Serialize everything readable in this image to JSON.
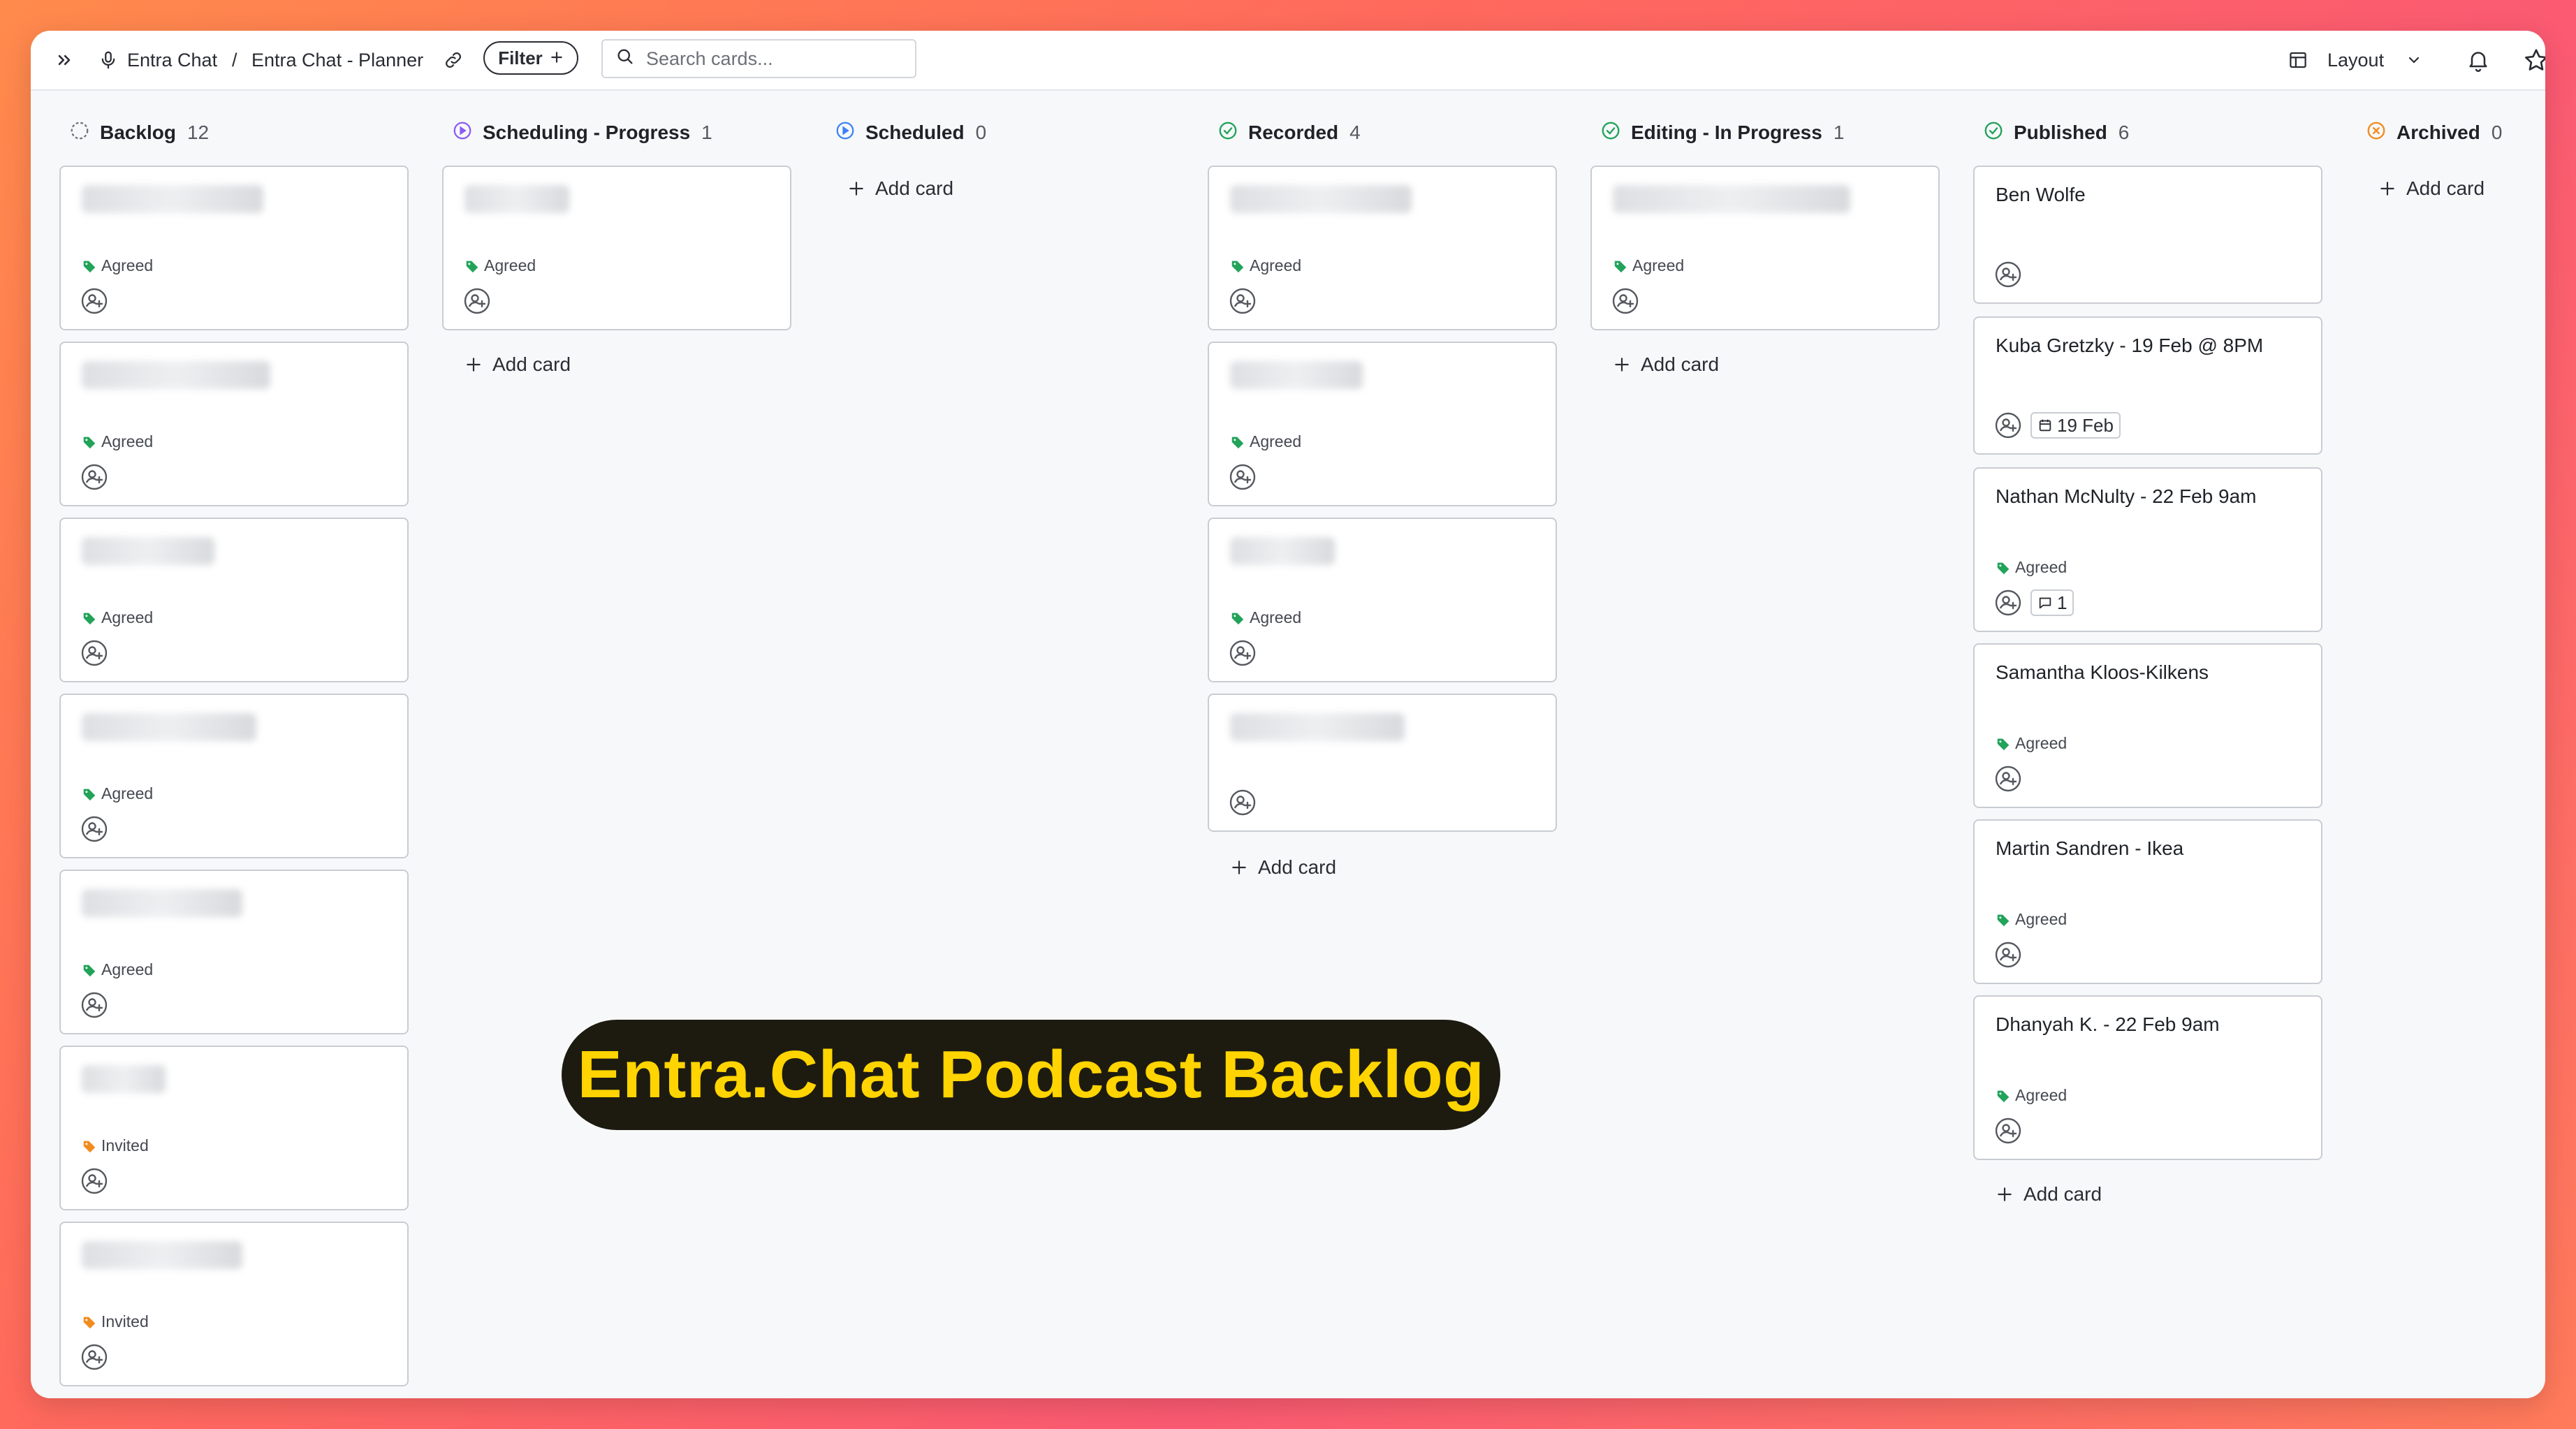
{
  "breadcrumb": {
    "workspace": "Entra Chat",
    "separator": "/",
    "page": "Entra Chat - Planner"
  },
  "filter_label": "Filter",
  "search": {
    "placeholder": "Search cards..."
  },
  "layout_label": "Layout",
  "colors": {
    "agreed_tag": "#22a35a",
    "invited_tag": "#f28c1e",
    "scheduled_icon": "#3b82f6",
    "progress_icon": "#8b5cf6",
    "done_icon": "#22a35a",
    "archived_icon": "#f28c1e",
    "banner_bg": "#1d1b10",
    "banner_text": "#ffd400"
  },
  "columns": [
    {
      "title": "Backlog",
      "count": "12",
      "icon": "dashed-circle-icon",
      "cards": [
        {
          "tag": "Agreed"
        },
        {
          "tag": "Agreed"
        },
        {
          "tag": "Agreed"
        },
        {
          "tag": "Agreed"
        },
        {
          "tag": "Agreed"
        },
        {
          "tag": "Invited"
        },
        {
          "tag": "Invited"
        }
      ]
    },
    {
      "title": "Scheduling - Progress",
      "count": "1",
      "icon": "play-circle-icon",
      "cards": [
        {
          "tag": "Agreed"
        }
      ],
      "add_card": "Add card"
    },
    {
      "title": "Scheduled",
      "count": "0",
      "icon": "play-circle-icon",
      "cards": [],
      "add_card": "Add card"
    },
    {
      "title": "Recorded",
      "count": "4",
      "icon": "check-circle-icon",
      "cards": [
        {
          "tag": "Agreed"
        },
        {
          "tag": "Agreed"
        },
        {
          "tag": "Agreed"
        },
        {
          "tag": ""
        }
      ],
      "add_card": "Add card"
    },
    {
      "title": "Editing - In Progress",
      "count": "1",
      "icon": "check-circle-icon",
      "cards": [
        {
          "tag": "Agreed"
        }
      ],
      "add_card": "Add card"
    },
    {
      "title": "Published",
      "count": "6",
      "icon": "check-circle-icon",
      "cards": [
        {
          "title": "Ben Wolfe"
        },
        {
          "title": "Kuba Gretzky - 19 Feb @ 8PM",
          "date": "19 Feb"
        },
        {
          "title": "Nathan McNulty - 22 Feb 9am",
          "tag": "Agreed",
          "comments": "1"
        },
        {
          "title": "Samantha Kloos-Kilkens",
          "tag": "Agreed"
        },
        {
          "title": "Martin Sandren - Ikea",
          "tag": "Agreed"
        },
        {
          "title": "Dhanyah K. - 22 Feb 9am",
          "tag": "Agreed"
        }
      ],
      "add_card": "Add card"
    },
    {
      "title": "Archived",
      "count": "0",
      "icon": "x-circle-icon",
      "cards": [],
      "add_card": "Add card"
    }
  ],
  "banner_text": "Entra.Chat Podcast Backlog"
}
